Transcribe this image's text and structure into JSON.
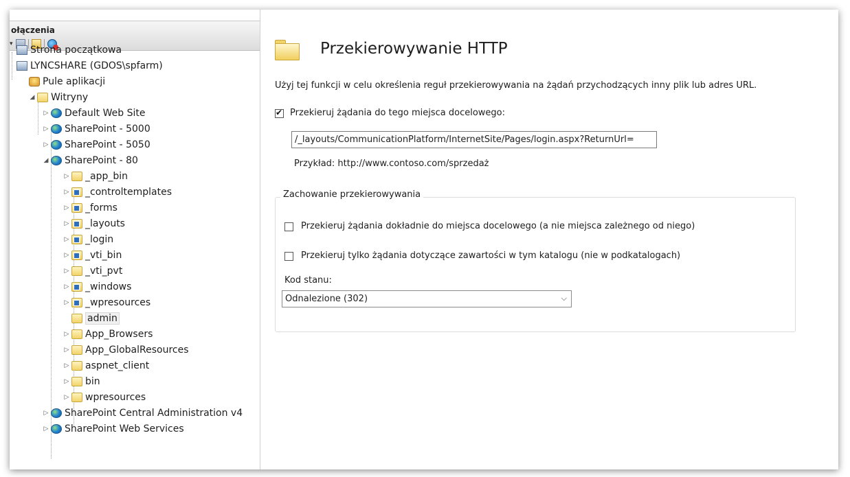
{
  "left_pane": {
    "title": "ołączenia",
    "tree": [
      {
        "label": "Strona początkowa",
        "icon": "home-server-icon",
        "expander": ""
      },
      {
        "label": "LYNCSHARE (GDOS\\spfarm)",
        "icon": "server-icon",
        "expander": ""
      },
      {
        "label": "Pule aplikacji",
        "icon": "app-pool-icon",
        "expander": ""
      },
      {
        "label": "Witryny",
        "icon": "sites-folder-icon",
        "expander": "◢"
      },
      {
        "label": "Default Web Site",
        "icon": "globe-icon",
        "expander": "▷"
      },
      {
        "label": "SharePoint - 5000",
        "icon": "globe-icon",
        "expander": "▷"
      },
      {
        "label": "SharePoint - 5050",
        "icon": "globe-icon",
        "expander": "▷"
      },
      {
        "label": "SharePoint - 80",
        "icon": "globe-icon",
        "expander": "◢"
      },
      {
        "label": "_app_bin",
        "icon": "folder-icon",
        "expander": "▷"
      },
      {
        "label": "_controltemplates",
        "icon": "virtual-folder-icon",
        "expander": "▷"
      },
      {
        "label": "_forms",
        "icon": "virtual-folder-icon",
        "expander": "▷"
      },
      {
        "label": "_layouts",
        "icon": "virtual-folder-icon",
        "expander": "▷"
      },
      {
        "label": "_login",
        "icon": "virtual-folder-icon",
        "expander": "▷"
      },
      {
        "label": "_vti_bin",
        "icon": "virtual-folder-icon",
        "expander": "▷"
      },
      {
        "label": "_vti_pvt",
        "icon": "folder-icon",
        "expander": "▷"
      },
      {
        "label": "_windows",
        "icon": "virtual-folder-icon",
        "expander": "▷"
      },
      {
        "label": "_wpresources",
        "icon": "virtual-folder-icon",
        "expander": "▷"
      },
      {
        "label": "admin",
        "icon": "folder-icon",
        "expander": ""
      },
      {
        "label": "App_Browsers",
        "icon": "folder-icon",
        "expander": "▷"
      },
      {
        "label": "App_GlobalResources",
        "icon": "folder-icon",
        "expander": "▷"
      },
      {
        "label": "aspnet_client",
        "icon": "folder-icon",
        "expander": "▷"
      },
      {
        "label": "bin",
        "icon": "folder-icon",
        "expander": "▷"
      },
      {
        "label": "wpresources",
        "icon": "folder-icon",
        "expander": "▷"
      },
      {
        "label": "SharePoint Central Administration v4",
        "icon": "globe-icon",
        "expander": "▷"
      },
      {
        "label": "SharePoint Web Services",
        "icon": "globe-icon",
        "expander": "▷"
      }
    ]
  },
  "main": {
    "title": "Przekierowywanie HTTP",
    "description": "Użyj tej funkcji w celu określenia reguł przekierowywania na żądań przychodzących inny plik lub adres URL.",
    "redirect_checkbox": {
      "label": "Przekieruj żądania do tego miejsca docelowego:",
      "checked": true
    },
    "url_value": "/_layouts/CommunicationPlatform/InternetSite/Pages/login.aspx?ReturnUrl=",
    "example": "Przykład: http://www.contoso.com/sprzedaż",
    "behavior_group": {
      "legend": "Zachowanie przekierowywania",
      "exact_checkbox": {
        "label": "Przekieruj żądania dokładnie do miejsca docelowego (a nie miejsca zależnego od niego)",
        "checked": false
      },
      "dir_only_checkbox": {
        "label": "Przekieruj tylko żądania dotyczące zawartości w tym katalogu (nie w podkatalogach)",
        "checked": false
      },
      "status_label": "Kod stanu:",
      "status_value": "Odnalezione (302)"
    }
  }
}
